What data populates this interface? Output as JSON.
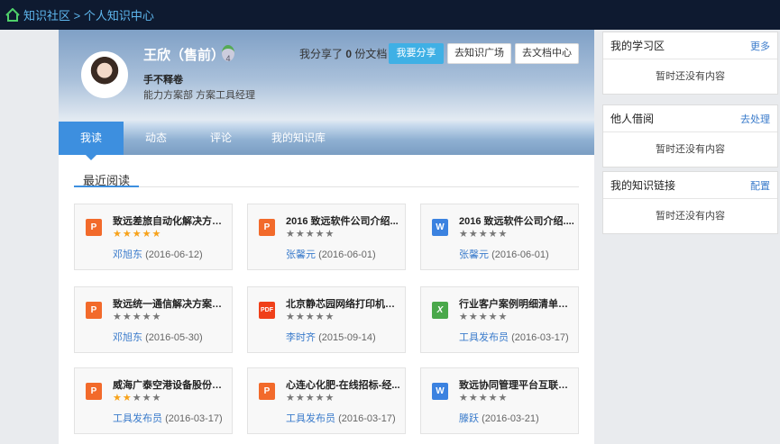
{
  "breadcrumb": {
    "home_icon": "home-icon",
    "text": "知识社区 > 个人知识中心"
  },
  "profile": {
    "name": "王欣（售前）",
    "level": "4",
    "motto": "手不释卷",
    "department": "能力方案部 方案工具经理",
    "share_prefix": "我分享了",
    "share_count": "0",
    "share_suffix": "份文档"
  },
  "buttons": {
    "share": "我要分享",
    "square": "去知识广场",
    "doc_center": "去文档中心"
  },
  "tabs": [
    {
      "label": "我读"
    },
    {
      "label": "动态"
    },
    {
      "label": "评论"
    },
    {
      "label": "我的知识库"
    }
  ],
  "section_title": "最近阅读",
  "cards": [
    {
      "type": "ppt",
      "icon": "P",
      "title": "致远差旅自动化解决方案...",
      "rating": 5,
      "author": "邓旭东",
      "date": "(2016-06-12)"
    },
    {
      "type": "ppt",
      "icon": "P",
      "title": "2016 致远软件公司介绍...",
      "rating": 0,
      "author": "张馨元",
      "date": "(2016-06-01)"
    },
    {
      "type": "doc",
      "icon": "W",
      "title": "2016 致远软件公司介绍....",
      "rating": 0,
      "author": "张馨元",
      "date": "(2016-06-01)"
    },
    {
      "type": "ppt",
      "icon": "P",
      "title": "致远统一通信解决方案（I...",
      "rating": 0,
      "author": "邓旭东",
      "date": "(2016-05-30)"
    },
    {
      "type": "pdf",
      "icon": "PDF",
      "title": "北京静芯园网络打印机安...",
      "rating": 0,
      "author": "李时齐",
      "date": "(2015-09-14)"
    },
    {
      "type": "xls",
      "icon": "X",
      "title": "行业客户案例明细清单V1...",
      "rating": 0,
      "author": "工具发布员",
      "date": "(2016-03-17)"
    },
    {
      "type": "ppt",
      "icon": "P",
      "title": "威海广泰空港设备股份有...",
      "rating": 2,
      "author": "工具发布员",
      "date": "(2016-03-17)"
    },
    {
      "type": "ppt",
      "icon": "P",
      "title": "心连心化肥-在线招标-经...",
      "rating": 0,
      "author": "工具发布员",
      "date": "(2016-03-17)"
    },
    {
      "type": "doc",
      "icon": "W",
      "title": "致远协同管理平台互联网...",
      "rating": 0,
      "author": "滕跃",
      "date": "(2016-03-21)"
    }
  ],
  "panels": [
    {
      "title": "我的学习区",
      "action": "更多",
      "empty": "暂时还没有内容"
    },
    {
      "title": "他人借阅",
      "action": "去处理",
      "empty": "暂时还没有内容"
    },
    {
      "title": "我的知识链接",
      "action": "配置",
      "empty": "暂时还没有内容"
    }
  ],
  "colors": {
    "accent": "#3d8fdf",
    "topbar": "#0e1a30",
    "star": "#f7a21b",
    "link": "#3a7bcb"
  }
}
